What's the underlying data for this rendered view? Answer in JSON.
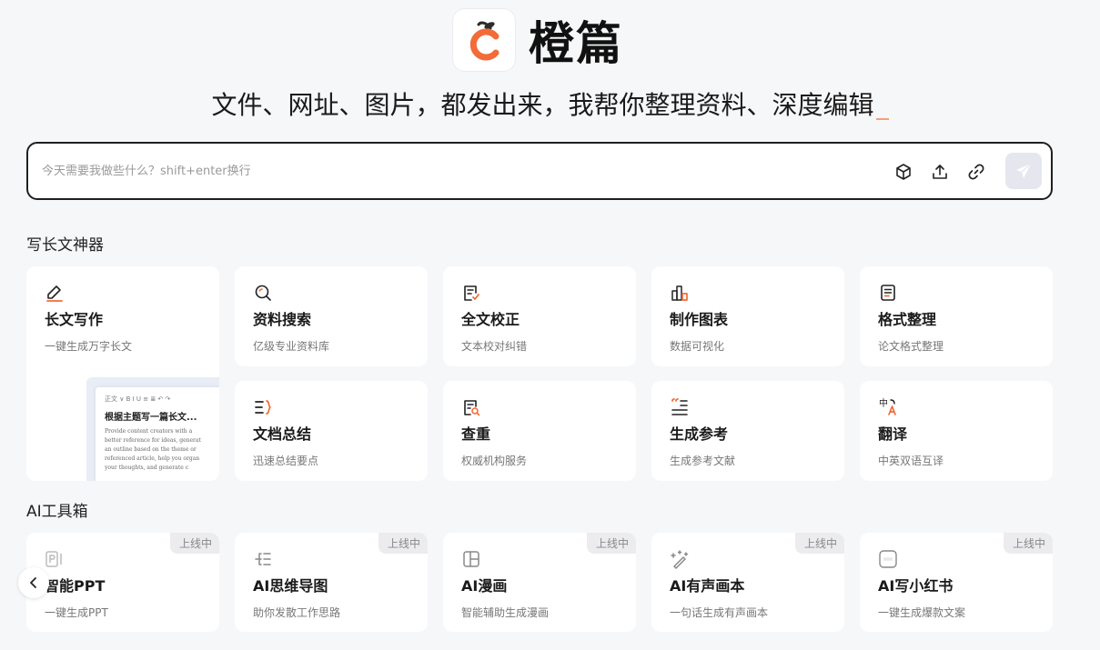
{
  "brand": {
    "name": "橙篇",
    "logo_icon": "orange-c-logo",
    "accent": "#f26b38"
  },
  "tagline": "文件、网址、图片，都发出来，我帮你整理资料、深度编辑",
  "prompt": {
    "placeholder": "今天需要我做些什么？shift+enter换行",
    "value": "",
    "tools": [
      "cube-icon",
      "upload-icon",
      "link-icon",
      "send-icon"
    ]
  },
  "sections": {
    "writing": {
      "title": "写长文神器",
      "cards": [
        {
          "title": "长文写作",
          "desc": "一键生成万字长文",
          "icon": "pencil-icon"
        },
        {
          "title": "资料搜索",
          "desc": "亿级专业资料库",
          "icon": "search-icon"
        },
        {
          "title": "全文校正",
          "desc": "文本校对纠错",
          "icon": "doc-check-icon"
        },
        {
          "title": "制作图表",
          "desc": "数据可视化",
          "icon": "bar-chart-icon"
        },
        {
          "title": "格式整理",
          "desc": "论文格式整理",
          "icon": "doc-format-icon"
        },
        {
          "title": "文档总结",
          "desc": "迅速总结要点",
          "icon": "summary-icon"
        },
        {
          "title": "查重",
          "desc": "权威机构服务",
          "icon": "doc-search-icon"
        },
        {
          "title": "生成参考",
          "desc": "生成参考文献",
          "icon": "quote-icon"
        },
        {
          "title": "翻译",
          "desc": "中英双语互译",
          "icon": "translate-icon"
        }
      ],
      "preview": {
        "toolbar": "正文 ∨  B  I  U  ≡  ≣  ↶  ↷",
        "heading": "根据主题写一篇长文...",
        "lines": [
          "Provide content creators with a",
          "better reference for ideas, generat",
          "an outline based on the theme or",
          "referenced article, help you organ",
          "your thoughts, and generate c"
        ]
      }
    },
    "tools": {
      "title": "AI工具箱",
      "badge": "上线中",
      "cards": [
        {
          "title": "智能PPT",
          "desc": "一键生成PPT",
          "icon": "ppt-icon"
        },
        {
          "title": "AI思维导图",
          "desc": "助你发散工作思路",
          "icon": "mindmap-icon"
        },
        {
          "title": "AI漫画",
          "desc": "智能辅助生成漫画",
          "icon": "comic-icon"
        },
        {
          "title": "AI有声画本",
          "desc": "一句话生成有声画本",
          "icon": "magic-wand-icon"
        },
        {
          "title": "AI写小红书",
          "desc": "一键生成爆款文案",
          "icon": "xiaohongshu-icon"
        }
      ]
    }
  }
}
